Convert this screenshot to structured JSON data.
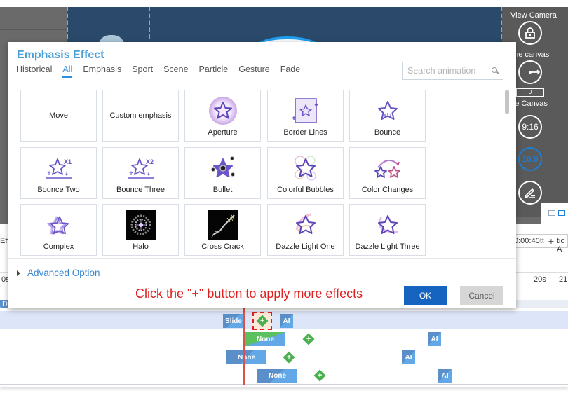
{
  "dialog": {
    "title": "Emphasis Effect",
    "tabs": [
      {
        "label": "Historical",
        "active": false
      },
      {
        "label": "All",
        "active": true
      },
      {
        "label": "Emphasis",
        "active": false
      },
      {
        "label": "Sport",
        "active": false
      },
      {
        "label": "Scene",
        "active": false
      },
      {
        "label": "Particle",
        "active": false
      },
      {
        "label": "Gesture",
        "active": false
      },
      {
        "label": "Fade",
        "active": false
      }
    ],
    "search_placeholder": "Search animation",
    "effects": [
      {
        "label": "Move",
        "icon": "none"
      },
      {
        "label": "Custom emphasis",
        "icon": "none"
      },
      {
        "label": "Aperture",
        "icon": "aperture-star-icon"
      },
      {
        "label": "Border Lines",
        "icon": "border-lines-star-icon"
      },
      {
        "label": "Bounce",
        "icon": "bounce-star-icon"
      },
      {
        "label": "Bounce Two",
        "icon": "bounce-x1-star-icon"
      },
      {
        "label": "Bounce Three",
        "icon": "bounce-x2-star-icon"
      },
      {
        "label": "Bullet",
        "icon": "bullet-star-icon"
      },
      {
        "label": "Colorful Bubbles",
        "icon": "colorful-bubbles-star-icon"
      },
      {
        "label": "Color Changes",
        "icon": "color-changes-star-icon"
      },
      {
        "label": "Complex",
        "icon": "complex-star-icon"
      },
      {
        "label": "Halo",
        "icon": "halo-thumbnail"
      },
      {
        "label": "Cross Crack",
        "icon": "cross-crack-thumbnail"
      },
      {
        "label": "Dazzle Light One",
        "icon": "dazzle-light-one-star-icon"
      },
      {
        "label": "Dazzle Light Three",
        "icon": "dazzle-light-three-star-icon"
      }
    ],
    "advanced_option": "Advanced Option",
    "hint": "Click the \"+\" button to apply more effects",
    "ok_label": "OK",
    "cancel_label": "Cancel"
  },
  "right_panel": {
    "view_camera": "View Camera",
    "lock_canvas": "ck the canvas",
    "rotate_value": "0",
    "rotate_canvas": "otate Canvas",
    "ratio_916": "9:16",
    "ratio_169": "16:9"
  },
  "editor": {
    "left_label": "Eff",
    "time_value": "0:00:40",
    "time_suffix": "tt",
    "plus": "+",
    "right_label": "tic A",
    "ruler": [
      "0s",
      "20s",
      "21"
    ],
    "strip_label": "D"
  },
  "timeline": {
    "tracks": [
      {
        "clips": [
          "Slide",
          "AI"
        ]
      },
      {
        "clips": [
          "None",
          "AI"
        ]
      },
      {
        "clips": [
          "None",
          "AI"
        ]
      },
      {
        "clips": [
          "None",
          "AI"
        ]
      }
    ]
  },
  "colors": {
    "accent": "#2d8fe0",
    "title": "#4a9fd8",
    "ok": "#1565c0",
    "hint": "#e02020",
    "add": "#4caf50"
  }
}
